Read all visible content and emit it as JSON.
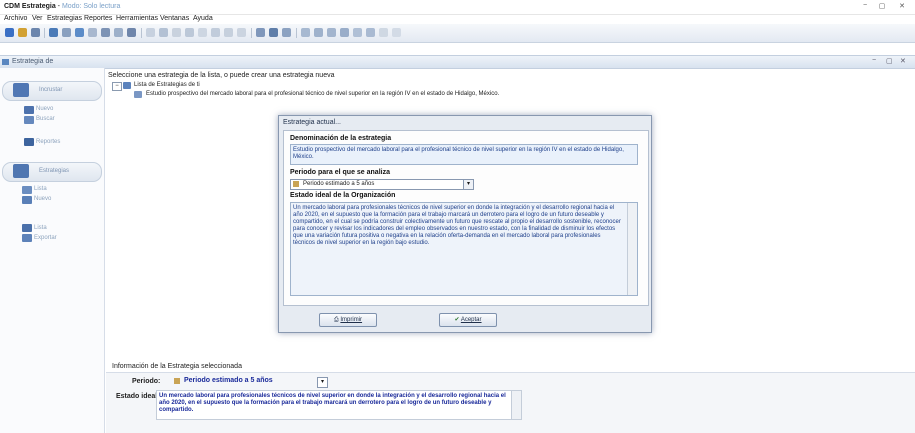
{
  "app": {
    "title_bold": "CDM Estrategia",
    "title_rest": " - ",
    "title_sub": "Modo: Solo lectura",
    "window_buttons": [
      "−",
      "▢",
      "✕"
    ]
  },
  "menu": [
    {
      "label": "Archivo"
    },
    {
      "label": "Ver"
    },
    {
      "label": "Estrategias"
    },
    {
      "label": "Reportes"
    },
    {
      "label": "Herramientas"
    },
    {
      "label": "Ventanas"
    },
    {
      "label": "Ayuda"
    }
  ],
  "panel": {
    "header_label": "Estrategia de",
    "header_buttons": [
      "−",
      "▢",
      "✕"
    ]
  },
  "sidebar": {
    "groups": [
      {
        "label": "Incrustar"
      },
      {
        "label": "Nuevo"
      },
      {
        "label": "Buscar"
      },
      {
        "label": "Reportes"
      },
      {
        "label": "Estrategias"
      },
      {
        "label": "Lista"
      },
      {
        "label": "Nuevo"
      },
      {
        "label": "Lista"
      },
      {
        "label": "Exportar"
      }
    ]
  },
  "main": {
    "hint": "Seleccione una estrategia de la lista, o puede crear una estrategia nueva",
    "tree_root": "Lista de Estrategias de ti",
    "tree_child": "Estudio prospectivo del mercado laboral para el profesional técnico de nivel superior en la región IV en el estado de Hidalgo, México."
  },
  "dialog": {
    "title": "Estrategia actual...",
    "name_title": "Denominación de la estrategia",
    "name_value": "Estudio prospectivo del mercado laboral para el profesional técnico de nivel superior en la región IV en el estado de Hidalgo, México.",
    "period_title": "Periodo para el que se analiza",
    "period_value": "Periodo estimado a 5 años",
    "ideal_title": "Estado ideal de la Organización",
    "ideal_value": "Un mercado laboral para profesionales técnicos de nivel superior en donde la integración y el desarrollo regional hacia el año 2020, en el supuesto que la formación para el trabajo marcará un derrotero para el logro de un futuro deseable y compartido, en el cual se podría construir colectivamente un futuro que rescate al propio el desarrollo sostenible, reconocer para conocer y revisar los indicadores del empleo observados en nuestro estado, con la finalidad de disminuir los efectos que una variación futura positiva o negativa en la relación oferta-demanda en el mercado laboral para profesionales técnicos de nivel superior en la región bajo estudio.",
    "print_label": "Imprimir",
    "accept_label": "Aceptar"
  },
  "info": {
    "header": "Información de la Estrategia seleccionada",
    "period_label": "Periodo:",
    "period_value": "Periodo estimado a 5 años",
    "ideal_label": "Estado ideal:",
    "ideal_value": "Un mercado laboral para profesionales técnicos de nivel superior en donde la integración y el desarrollo regional hacia el año 2020, en el supuesto que la formación para el trabajo marcará un derrotero para el logro de un futuro deseable y compartido."
  }
}
